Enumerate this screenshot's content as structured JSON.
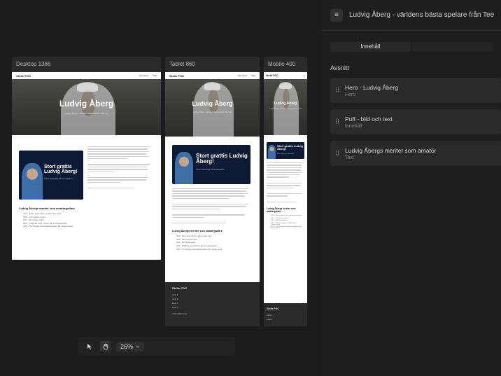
{
  "frames": {
    "desktop": {
      "label": "Desktop 1366"
    },
    "tablet": {
      "label": "Tablet 860"
    },
    "mobile": {
      "label": "Mobile 400"
    }
  },
  "site": {
    "brand": "Skrite POC",
    "nav_links": [
      "Menylänk",
      "Sida"
    ],
    "hero_title": "Ludvig Åberg",
    "hero_subtitle": "Ludvig Åberg – världens bästa spelare från Tee",
    "puff_title": "Stort grattis Ludvig Åberg!",
    "puff_subtitle": "Årets talanglag på idrottsgalan",
    "list_title": "Ludvig Åbergs meriter som amatörgolfare",
    "list_items": [
      "2019 – Silver, Junior Open, Ludvig Lucker Open",
      "2020 – Fred Haskins Award",
      "2021 – Ben Hogan Award",
      "2022 – Individuell seger i NCAA, Big 12 Championship",
      "2023 – The Prestige, Jack Nicklaus Award, Ben Hogan Award"
    ],
    "footer_brand": "Skrite POC",
    "footer_links": [
      "Länk 1",
      "Länk 2",
      "Länk 3",
      "Länk 4"
    ],
    "footer_extra": "Skrite hjälpcenter"
  },
  "toolbar": {
    "zoom": "26%",
    "zoom_chevron": "chevron-down-icon"
  },
  "panel": {
    "title": "Ludvig Åberg - världens bästa spelare från Tee",
    "tabs": [
      "Innehåll",
      ""
    ],
    "section_label": "Avsnitt",
    "sections": [
      {
        "title": "Hero - Ludvig Åberg",
        "subtitle": "Hero"
      },
      {
        "title": "Puff - bild och text",
        "subtitle": "Innehåll"
      },
      {
        "title": "Ludvig Åbergs meriter som amatör",
        "subtitle": "Text"
      }
    ]
  }
}
